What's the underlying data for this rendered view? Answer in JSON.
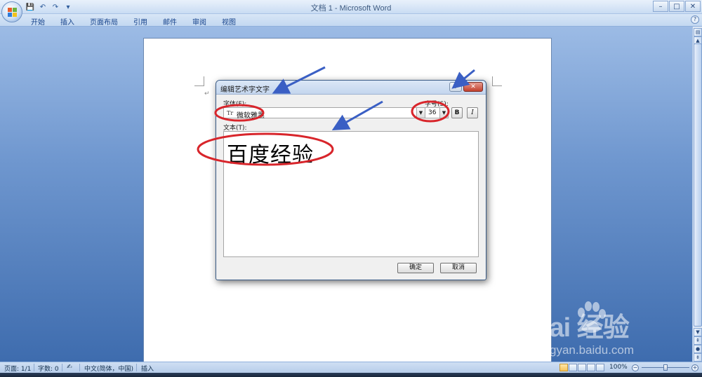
{
  "window": {
    "title": "文档 1 - Microsoft Word",
    "controls": [
      "–",
      "□",
      "✕"
    ]
  },
  "quick_access": {
    "icons": [
      "save-icon",
      "undo-icon",
      "redo-icon",
      "customize-icon"
    ],
    "glyphs": [
      "💾",
      "↶",
      "↷",
      "▾"
    ]
  },
  "ribbon": {
    "tabs": [
      "开始",
      "插入",
      "页面布局",
      "引用",
      "邮件",
      "审阅",
      "视图"
    ],
    "help": "?"
  },
  "dialog": {
    "title": "编辑艺术字文字",
    "help": "?",
    "close": "✕",
    "font_label": "字体(F):",
    "font_value": "微软雅黑",
    "font_prefix": "Tr",
    "size_label": "字号(S):",
    "size_value": "36",
    "bold": "B",
    "italic": "I",
    "text_label": "文本(T):",
    "text_value": "百度经验",
    "ok_label": "确定",
    "cancel_label": "取消"
  },
  "statusbar": {
    "page": "页面: 1/1",
    "words": "字数: 0",
    "language": "中文(简体，中国)",
    "mode": "插入",
    "zoom": "100%",
    "zoom_minus": "−",
    "zoom_plus": "+",
    "zoom_level": 0.5
  },
  "watermark": {
    "brand": "Bai  经验",
    "url": "jingyan.baidu.com"
  },
  "annotations": {
    "color_arrows": "#3a5fc4",
    "color_ellipses": "#d8252b"
  },
  "colors": {
    "office_logo": [
      "#e85b2a",
      "#6cb33f",
      "#2f7bd9",
      "#f2c21c"
    ]
  }
}
